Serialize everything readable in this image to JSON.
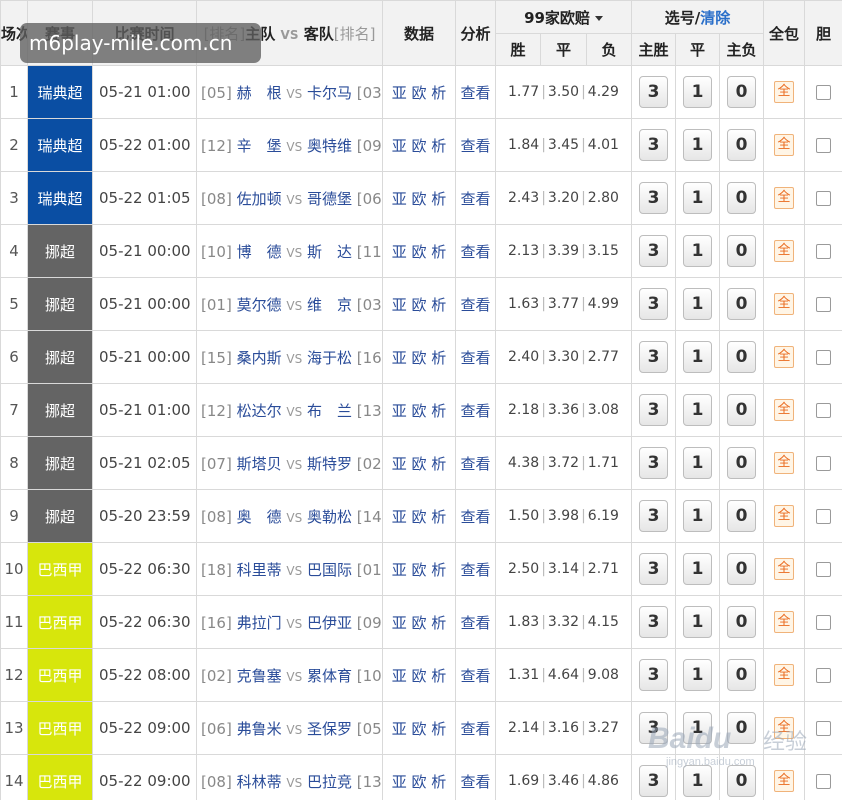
{
  "headers": {
    "no": "场次",
    "league": "赛事",
    "time": "比赛时间",
    "rank": "[排名]",
    "home": "主队",
    "vs": "VS",
    "away": "客队",
    "data": "数据",
    "analysis": "分析",
    "odds_group": "99家欧赔",
    "select_group": "选号/",
    "clear": "清除",
    "all": "全包",
    "dan": "胆",
    "win": "胜",
    "draw": "平",
    "lose": "负",
    "home_win": "主胜",
    "pick_draw": "平",
    "away_win": "主负"
  },
  "link_odds": "亚 欧 析",
  "link_view": "查看",
  "pick_labels": [
    "3",
    "1",
    "0"
  ],
  "all_label": "全",
  "watermark": "m6play-mile.com.cn",
  "baidu": {
    "logo": "Baidu",
    "cn": "经验",
    "url": "jingyan.baidu.com"
  },
  "colors": {
    "league_swe": "#0a4ea3",
    "league_nor": "#646464",
    "league_bra": "#d7e60c"
  },
  "matches": [
    {
      "no": "1",
      "league": "瑞典超",
      "lt": "swe",
      "time": "05-21 01:00",
      "hr": "[05]",
      "home": "赫　根",
      "away": "卡尔马",
      "ar": "[03]",
      "w": "1.77",
      "d": "3.50",
      "l": "4.29"
    },
    {
      "no": "2",
      "league": "瑞典超",
      "lt": "swe",
      "time": "05-22 01:00",
      "hr": "[12]",
      "home": "辛　堡",
      "away": "奥特维",
      "ar": "[09]",
      "w": "1.84",
      "d": "3.45",
      "l": "4.01"
    },
    {
      "no": "3",
      "league": "瑞典超",
      "lt": "swe",
      "time": "05-22 01:05",
      "hr": "[08]",
      "home": "佐加顿",
      "away": "哥德堡",
      "ar": "[06]",
      "w": "2.43",
      "d": "3.20",
      "l": "2.80"
    },
    {
      "no": "4",
      "league": "挪超",
      "lt": "nor",
      "time": "05-21 00:00",
      "hr": "[10]",
      "home": "博　德",
      "away": "斯　达",
      "ar": "[11]",
      "w": "2.13",
      "d": "3.39",
      "l": "3.15"
    },
    {
      "no": "5",
      "league": "挪超",
      "lt": "nor",
      "time": "05-21 00:00",
      "hr": "[01]",
      "home": "莫尔德",
      "away": "维　京",
      "ar": "[03]",
      "w": "1.63",
      "d": "3.77",
      "l": "4.99"
    },
    {
      "no": "6",
      "league": "挪超",
      "lt": "nor",
      "time": "05-21 00:00",
      "hr": "[15]",
      "home": "桑内斯",
      "away": "海于松",
      "ar": "[16]",
      "w": "2.40",
      "d": "3.30",
      "l": "2.77"
    },
    {
      "no": "7",
      "league": "挪超",
      "lt": "nor",
      "time": "05-21 01:00",
      "hr": "[12]",
      "home": "松达尔",
      "away": "布　兰",
      "ar": "[13]",
      "w": "2.18",
      "d": "3.36",
      "l": "3.08"
    },
    {
      "no": "8",
      "league": "挪超",
      "lt": "nor",
      "time": "05-21 02:05",
      "hr": "[07]",
      "home": "斯塔贝",
      "away": "斯特罗",
      "ar": "[02]",
      "w": "4.38",
      "d": "3.72",
      "l": "1.71"
    },
    {
      "no": "9",
      "league": "挪超",
      "lt": "nor",
      "time": "05-20 23:59",
      "hr": "[08]",
      "home": "奥　德",
      "away": "奥勒松",
      "ar": "[14]",
      "w": "1.50",
      "d": "3.98",
      "l": "6.19"
    },
    {
      "no": "10",
      "league": "巴西甲",
      "lt": "bra",
      "time": "05-22 06:30",
      "hr": "[18]",
      "home": "科里蒂",
      "away": "巴国际",
      "ar": "[01]",
      "w": "2.50",
      "d": "3.14",
      "l": "2.71"
    },
    {
      "no": "11",
      "league": "巴西甲",
      "lt": "bra",
      "time": "05-22 06:30",
      "hr": "[16]",
      "home": "弗拉门",
      "away": "巴伊亚",
      "ar": "[09]",
      "w": "1.83",
      "d": "3.32",
      "l": "4.15"
    },
    {
      "no": "12",
      "league": "巴西甲",
      "lt": "bra",
      "time": "05-22 08:00",
      "hr": "[02]",
      "home": "克鲁塞",
      "away": "累体育",
      "ar": "[10]",
      "w": "1.31",
      "d": "4.64",
      "l": "9.08"
    },
    {
      "no": "13",
      "league": "巴西甲",
      "lt": "bra",
      "time": "05-22 09:00",
      "hr": "[06]",
      "home": "弗鲁米",
      "away": "圣保罗",
      "ar": "[05]",
      "w": "2.14",
      "d": "3.16",
      "l": "3.27"
    },
    {
      "no": "14",
      "league": "巴西甲",
      "lt": "bra",
      "time": "05-22 09:00",
      "hr": "[08]",
      "home": "科林蒂",
      "away": "巴拉竞",
      "ar": "[13]",
      "w": "1.69",
      "d": "3.46",
      "l": "4.86"
    }
  ]
}
